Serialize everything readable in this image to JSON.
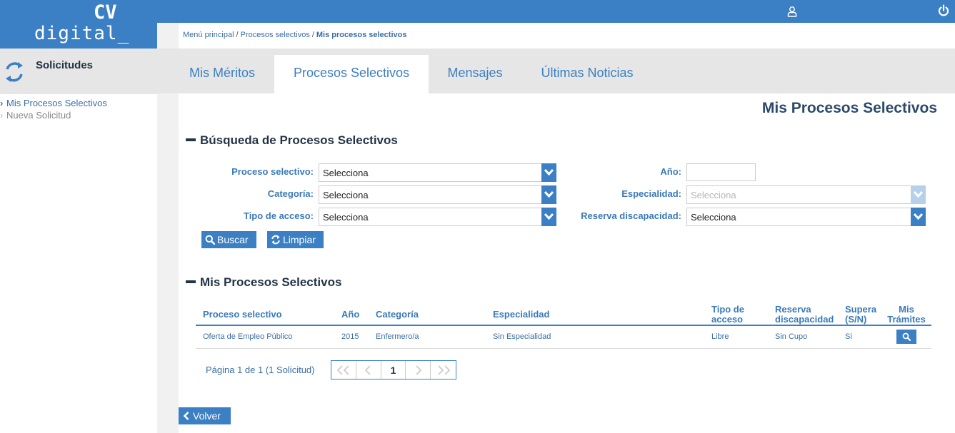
{
  "logo": {
    "line1": "CV",
    "line2": "digital_"
  },
  "header": {
    "user_icon": "user-icon",
    "power_icon": "power-icon"
  },
  "sidebar": {
    "title": "Solicitudes",
    "icon": "refresh-icon",
    "items": [
      {
        "label": "Mis Procesos Selectivos",
        "active": true
      },
      {
        "label": "Nueva Solicitud",
        "active": false
      }
    ]
  },
  "breadcrumb": {
    "items": [
      "Menú principal",
      "Procesos selectivos",
      "Mis procesos selectivos"
    ]
  },
  "tabs": [
    {
      "label": "Mis Méritos",
      "active": false
    },
    {
      "label": "Procesos Selectivos",
      "active": true
    },
    {
      "label": "Mensajes",
      "active": false
    },
    {
      "label": "Últimas Noticias",
      "active": false
    }
  ],
  "page_title": "Mis Procesos Selectivos",
  "search": {
    "title": "Búsqueda de Procesos Selectivos",
    "fields": {
      "proceso": {
        "label": "Proceso selectivo:",
        "value": "Selecciona"
      },
      "categoria": {
        "label": "Categoría:",
        "value": "Selecciona"
      },
      "tipo_acceso": {
        "label": "Tipo de acceso:",
        "value": "Selecciona"
      },
      "anio": {
        "label": "Año:",
        "value": ""
      },
      "especialidad": {
        "label": "Especialidad:",
        "value": "Selecciona",
        "disabled": true
      },
      "reserva": {
        "label": "Reserva discapacidad:",
        "value": "Selecciona"
      }
    },
    "buttons": {
      "buscar": "Buscar",
      "limpiar": "Limpiar"
    }
  },
  "results": {
    "title": "Mis Procesos Selectivos",
    "columns": {
      "proceso": "Proceso selectivo",
      "anio": "Año",
      "categoria": "Categoría",
      "especialidad": "Especialidad",
      "tipo_acceso_1": "Tipo de",
      "tipo_acceso_2": "acceso",
      "reserva_1": "Reserva",
      "reserva_2": "discapacidad",
      "supera_1": "Supera",
      "supera_2": "(S/N)",
      "tramites_1": "Mis",
      "tramites_2": "Trámites"
    },
    "rows": [
      {
        "proceso": "Oferta de Empleo Público",
        "anio": "2015",
        "categoria": "Enfermero/a",
        "especialidad": "Sin Especialidad",
        "tipo_acceso": "Libre",
        "reserva": "Sin Cupo",
        "supera": "Si"
      }
    ],
    "pagination": {
      "text": "Página 1 de 1 (1 Solicitud)",
      "current": "1"
    }
  },
  "back_button": "Volver",
  "colors": {
    "primary": "#3b7fc4",
    "heading": "#233447",
    "tab_bg": "#e6e6e6"
  }
}
